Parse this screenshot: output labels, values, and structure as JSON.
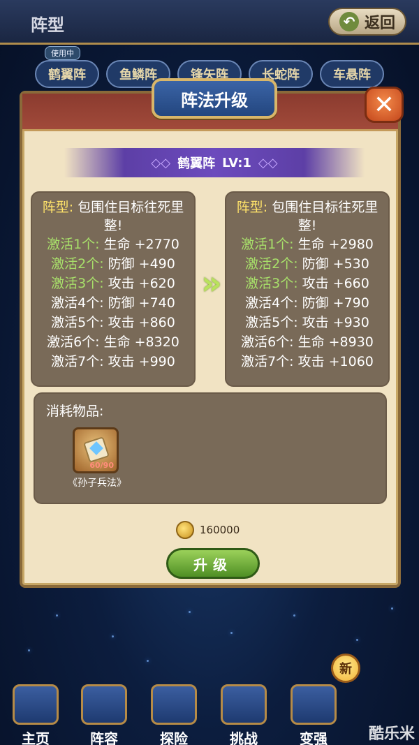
{
  "header": {
    "title": "阵型",
    "back_label": "返回"
  },
  "formation_tabs": [
    "鹤翼阵",
    "鱼鳞阵",
    "锋矢阵",
    "长蛇阵",
    "车悬阵"
  ],
  "in_use_label": "使用中",
  "modal": {
    "title": "阵法升级",
    "formation_name": "鹤翼阵",
    "level": "LV:1",
    "current": {
      "desc_key": "阵型:",
      "desc_text": "包围住目标往死里整!",
      "rows": [
        {
          "label": "激活1个:",
          "stat": "生命 +2770",
          "active": true
        },
        {
          "label": "激活2个:",
          "stat": "防御 +490",
          "active": true
        },
        {
          "label": "激活3个:",
          "stat": "攻击 +620",
          "active": true
        },
        {
          "label": "激活4个:",
          "stat": "防御 +740",
          "active": false
        },
        {
          "label": "激活5个:",
          "stat": "攻击 +860",
          "active": false
        },
        {
          "label": "激活6个:",
          "stat": "生命 +8320",
          "active": false
        },
        {
          "label": "激活7个:",
          "stat": "攻击 +990",
          "active": false
        }
      ]
    },
    "next": {
      "desc_key": "阵型:",
      "desc_text": "包围住目标往死里整!",
      "rows": [
        {
          "label": "激活1个:",
          "stat": "生命 +2980",
          "active": true
        },
        {
          "label": "激活2个:",
          "stat": "防御 +530",
          "active": true
        },
        {
          "label": "激活3个:",
          "stat": "攻击 +660",
          "active": true
        },
        {
          "label": "激活4个:",
          "stat": "防御 +790",
          "active": false
        },
        {
          "label": "激活5个:",
          "stat": "攻击 +930",
          "active": false
        },
        {
          "label": "激活6个:",
          "stat": "生命 +8930",
          "active": false
        },
        {
          "label": "激活7个:",
          "stat": "攻击 +1060",
          "active": false
        }
      ]
    },
    "cost": {
      "label": "消耗物品:",
      "item_name": "《孙子兵法》",
      "item_count": "60/90"
    },
    "gold": "160000",
    "upgrade_label": "升级",
    "close_icon": "close-x"
  },
  "bottom_nav": [
    {
      "label": "主页",
      "icon": "crystal-icon"
    },
    {
      "label": "阵容",
      "icon": "figure-icon"
    },
    {
      "label": "探险",
      "icon": "portal-icon"
    },
    {
      "label": "挑战",
      "icon": "fist-icon"
    },
    {
      "label": "变强",
      "icon": "book-icon"
    }
  ],
  "new_badge": "新",
  "watermark": "酷乐米",
  "colors": {
    "accent_green": "#b9e25c",
    "active_text": "#a8e06a",
    "key_text": "#ffe36a"
  }
}
